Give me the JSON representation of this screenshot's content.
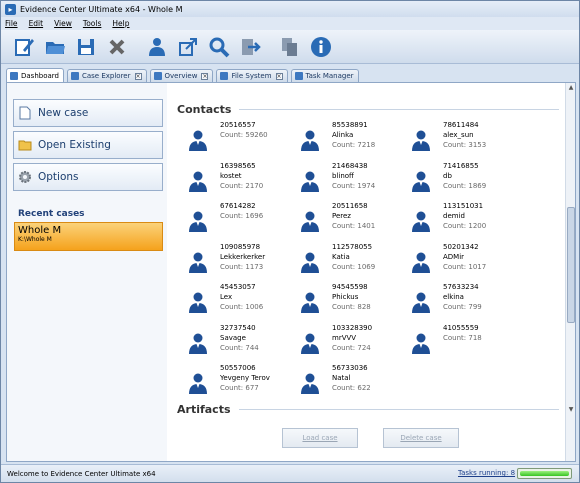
{
  "window": {
    "title": "Evidence Center Ultimate x64 - Whole M"
  },
  "menu": [
    "File",
    "Edit",
    "View",
    "Tools",
    "Help"
  ],
  "toolbar": {
    "icons": [
      "edit-icon",
      "open-folder-icon",
      "save-icon",
      "close-x-icon",
      "user-icon",
      "export-icon",
      "search-icon",
      "import-icon",
      "copy-icon",
      "info-icon"
    ]
  },
  "tabs": [
    {
      "label": "Dashboard",
      "active": true
    },
    {
      "label": "Case Explorer"
    },
    {
      "label": "Overview"
    },
    {
      "label": "File System"
    },
    {
      "label": "Task Manager"
    }
  ],
  "left": {
    "new_case": "New case",
    "open_existing": "Open Existing",
    "options": "Options",
    "recent_title": "Recent cases",
    "recent": {
      "name": "Whole M",
      "path": "K:\\Whole M"
    }
  },
  "main": {
    "contacts_title": "Contacts",
    "artifacts_title": "Artifacts",
    "contacts": [
      {
        "id": "20516557",
        "name": "",
        "count": "Count: 59260"
      },
      {
        "id": "85538891",
        "name": "Alinka",
        "count": "Count: 7218"
      },
      {
        "id": "78611484",
        "name": "alex_sun",
        "count": "Count: 3153"
      },
      {
        "id": "16398565",
        "name": "kostet",
        "count": "Count: 2170"
      },
      {
        "id": "21468438",
        "name": "blinoff",
        "count": "Count: 1974"
      },
      {
        "id": "71416855",
        "name": "db",
        "count": "Count: 1869"
      },
      {
        "id": "67614282",
        "name": "",
        "count": "Count: 1696"
      },
      {
        "id": "20511658",
        "name": "Perez",
        "count": "Count: 1401"
      },
      {
        "id": "113151031",
        "name": "demid",
        "count": "Count: 1200"
      },
      {
        "id": "109085978",
        "name": "Lekkerkerker",
        "count": "Count: 1173"
      },
      {
        "id": "112578055",
        "name": "Katia",
        "count": "Count: 1069"
      },
      {
        "id": "50201342",
        "name": "ADMir",
        "count": "Count: 1017"
      },
      {
        "id": "45453057",
        "name": "Lex",
        "count": "Count: 1006"
      },
      {
        "id": "94545598",
        "name": "Phickus",
        "count": "Count: 828"
      },
      {
        "id": "57633234",
        "name": "elkina",
        "count": "Count: 799"
      },
      {
        "id": "32737540",
        "name": "Savage",
        "count": "Count: 744"
      },
      {
        "id": "103328390",
        "name": "mrVVV",
        "count": "Count: 724"
      },
      {
        "id": "41055559",
        "name": "",
        "count": "Count: 718"
      },
      {
        "id": "50557006",
        "name": "Yevgeny Terov",
        "count": "Count: 677"
      },
      {
        "id": "56733036",
        "name": "Natal",
        "count": "Count: 622"
      }
    ],
    "load_case": "Load case",
    "delete_case": "Delete case"
  },
  "status": {
    "text": "Welcome to Evidence Center Ultimate x64",
    "tasks": "Tasks running: 8",
    "progress": 1.0
  },
  "colors": {
    "accent": "#2a6bb5",
    "recent_bg": "#f5a21c",
    "person": "#1f4f95"
  }
}
